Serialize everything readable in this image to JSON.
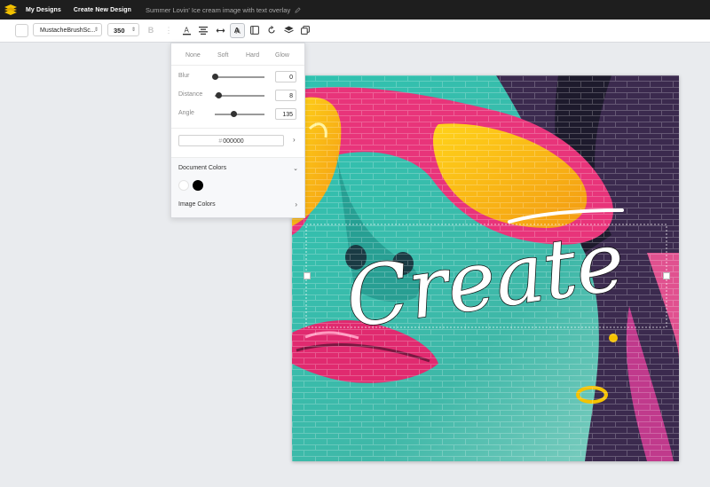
{
  "topbar": {
    "nav": [
      "My Designs",
      "Create New Design"
    ],
    "doc_title": "Summer Lovin' Ice cream image with text overlay"
  },
  "toolbar": {
    "font_family": "MustacheBrushSc...",
    "font_size": "350"
  },
  "shadow_panel": {
    "presets": [
      "None",
      "Soft",
      "Hard",
      "Glow"
    ],
    "sliders": [
      {
        "label": "Blur",
        "value": "0",
        "level": 0.0
      },
      {
        "label": "Distance",
        "value": "8",
        "level": 0.08
      },
      {
        "label": "Angle",
        "value": "135",
        "level": 0.375
      }
    ],
    "hex_value": "000000",
    "hash": "#",
    "document_colors_label": "Document Colors",
    "document_colors": [
      "#ffffff",
      "#000000"
    ],
    "image_colors_label": "Image Colors"
  },
  "canvas": {
    "overlay_text": "Create"
  },
  "colors": {
    "topbar": "#1e1e1e",
    "logo": "#f2c200",
    "workspace": "#e9ebee"
  }
}
